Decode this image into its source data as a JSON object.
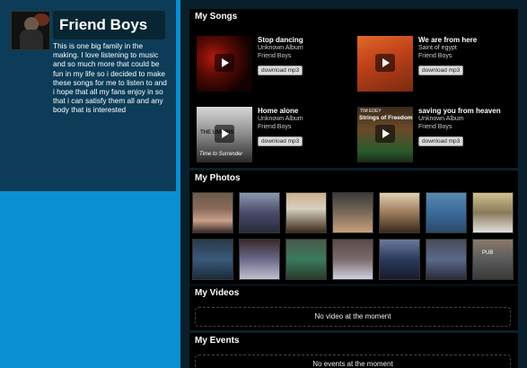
{
  "profile": {
    "name": "Friend Boys",
    "bio": "This is one big family in the making. I love listening to music and so much more that could be fun in my life so i decided to make these songs for me to listen to and i hope that all my fans enjoy in so that i can satisfy them all and any body that is interested"
  },
  "songs_section": {
    "title": "My Songs",
    "songs": [
      {
        "title": "Stop dancing",
        "album": "Unknown Album",
        "artist": "Friend Boys",
        "download_label": "download mp3"
      },
      {
        "title": "We are from here",
        "album": "Saint of egypt",
        "artist": "Friend Boys",
        "download_label": "download mp3"
      },
      {
        "title": "Home alone",
        "album": "Unknown Album",
        "artist": "Friend Boys",
        "download_label": "download mp3"
      },
      {
        "title": "saving you from heaven",
        "album": "Unknown Album",
        "artist": "Friend Boys",
        "download_label": "download mp3"
      }
    ],
    "thumb_text": {
      "song3_line1": "THE UMBRIS",
      "song3_line2": "Time to Surrender",
      "song4_top": "TIM EDEY",
      "song4_title": "Strings of Freedom"
    }
  },
  "photos_section": {
    "title": "My Photos",
    "photo_count": 14,
    "overlay_text": "PUB"
  },
  "videos_section": {
    "title": "My Videos",
    "empty_message": "No video at the moment"
  },
  "events_section": {
    "title": "My Events",
    "empty_message": "No events at the moment"
  },
  "colors": {
    "page_blue": "#0a8fd1",
    "left_panel": "#0c3c57",
    "right_bg": "#09202c",
    "panel_bg": "#000000"
  }
}
